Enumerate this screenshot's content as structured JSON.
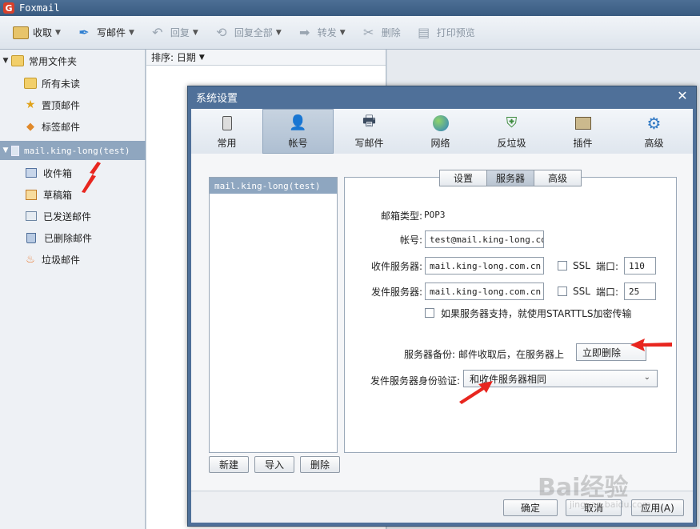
{
  "app": {
    "title": "Foxmail",
    "logo_letter": "G"
  },
  "toolbar": [
    {
      "label": "收取",
      "icon": "inbox-icon",
      "dropdown": true,
      "enabled": true
    },
    {
      "label": "写邮件",
      "icon": "write-icon",
      "dropdown": true,
      "enabled": true
    },
    {
      "label": "回复",
      "icon": "reply-icon",
      "dropdown": true,
      "enabled": false
    },
    {
      "label": "回复全部",
      "icon": "reply-all-icon",
      "dropdown": true,
      "enabled": false
    },
    {
      "label": "转发",
      "icon": "forward-icon",
      "dropdown": true,
      "enabled": false
    },
    {
      "label": "删除",
      "icon": "delete-icon",
      "dropdown": false,
      "enabled": false
    },
    {
      "label": "打印预览",
      "icon": "print-icon",
      "dropdown": false,
      "enabled": false
    }
  ],
  "sidebar": {
    "common_folder": "常用文件夹",
    "common_items": [
      "所有未读",
      "置顶邮件",
      "标签邮件"
    ],
    "account": "mail.king-long(test)",
    "account_items": [
      "收件箱",
      "草稿箱",
      "已发送邮件",
      "已删除邮件",
      "垃圾邮件"
    ]
  },
  "msglist": {
    "sort_label": "排序: 日期"
  },
  "dialog": {
    "title": "系统设置",
    "close": "✕",
    "tabs": [
      {
        "label": "常用",
        "icon": "settings-general-icon"
      },
      {
        "label": "帐号",
        "icon": "account-icon"
      },
      {
        "label": "写邮件",
        "icon": "compose-icon"
      },
      {
        "label": "网络",
        "icon": "network-icon"
      },
      {
        "label": "反垃圾",
        "icon": "antispam-shield-icon"
      },
      {
        "label": "插件",
        "icon": "plugin-icon"
      },
      {
        "label": "高级",
        "icon": "advanced-gear-icon"
      }
    ],
    "account_list": [
      "mail.king-long(test)"
    ],
    "account_buttons": [
      "新建",
      "导入",
      "删除"
    ],
    "subtabs": [
      "设置",
      "服务器",
      "高级"
    ],
    "form": {
      "mailbox_type_label": "邮箱类型:",
      "mailbox_type_value": "POP3",
      "account_label": "帐号:",
      "account_value": "test@mail.king-long.com",
      "incoming_label": "收件服务器:",
      "incoming_value": "mail.king-long.com.cn",
      "outgoing_label": "发件服务器:",
      "outgoing_value": "mail.king-long.com.cn",
      "ssl_label": "SSL",
      "port_label": "端口:",
      "incoming_port": "110",
      "outgoing_port": "25",
      "starttls_label": "如果服务器支持，就使用STARTTLS加密传输",
      "backup_label": "服务器备份:",
      "backup_text": "邮件收取后，在服务器上",
      "backup_option": "立即删除",
      "auth_label": "发件服务器身份验证:",
      "auth_option": "和收件服务器相同"
    },
    "footer_buttons": [
      "确定",
      "取消",
      "应用(A)"
    ]
  },
  "watermark": {
    "main": "Bai经验",
    "sub": "jingyan.baidu.com"
  }
}
